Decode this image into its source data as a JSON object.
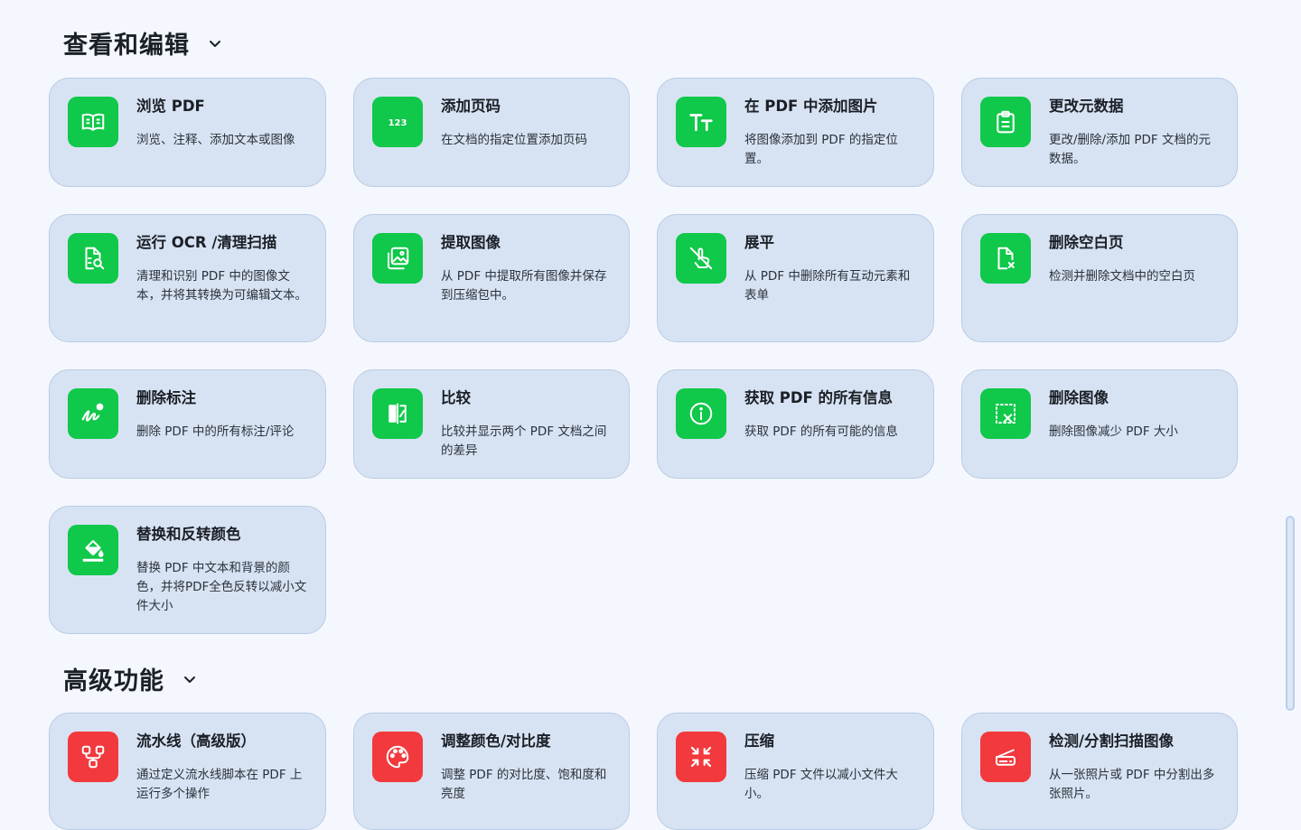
{
  "sections": [
    {
      "title": "查看和编辑"
    },
    {
      "title": "高级功能"
    }
  ],
  "cards": [
    {
      "title": "浏览 PDF",
      "desc": "浏览、注释、添加文本或图像",
      "icon": "book-open-icon"
    },
    {
      "title": "添加页码",
      "desc": "在文档的指定位置添加页码",
      "icon": "numbers-123-icon"
    },
    {
      "title": "在 PDF 中添加图片",
      "desc": "将图像添加到 PDF 的指定位置。",
      "icon": "text-size-icon"
    },
    {
      "title": "更改元数据",
      "desc": "更改/删除/添加 PDF 文档的元数据。",
      "icon": "clipboard-icon"
    },
    {
      "title": "运行 OCR /清理扫描",
      "desc": "清理和识别 PDF 中的图像文本，并将其转换为可编辑文本。",
      "icon": "file-search-icon"
    },
    {
      "title": "提取图像",
      "desc": "从 PDF 中提取所有图像并保存到压缩包中。",
      "icon": "image-stack-icon"
    },
    {
      "title": "展平",
      "desc": "从 PDF 中删除所有互动元素和表单",
      "icon": "touch-off-icon"
    },
    {
      "title": "删除空白页",
      "desc": "检测并删除文档中的空白页",
      "icon": "file-remove-icon"
    },
    {
      "title": "删除标注",
      "desc": "删除 PDF 中的所有标注/评论",
      "icon": "scribble-icon"
    },
    {
      "title": "比较",
      "desc": "比较并显示两个 PDF 文档之间的差异",
      "icon": "compare-icon"
    },
    {
      "title": "获取 PDF 的所有信息",
      "desc": "获取 PDF 的所有可能的信息",
      "icon": "info-icon"
    },
    {
      "title": "删除图像",
      "desc": "删除图像减少 PDF 大小",
      "icon": "image-remove-icon"
    },
    {
      "title": "替换和反转颜色",
      "desc": "替换 PDF 中文本和背景的颜色，并将PDF全色反转以减小文件大小",
      "icon": "paint-bucket-icon"
    },
    {
      "title": "流水线（高级版）",
      "desc": "通过定义流水线脚本在 PDF 上运行多个操作",
      "icon": "pipeline-icon"
    },
    {
      "title": "调整颜色/对比度",
      "desc": "调整 PDF 的对比度、饱和度和亮度",
      "icon": "palette-icon"
    },
    {
      "title": "压缩",
      "desc": "压缩 PDF 文件以减小文件大小。",
      "icon": "compress-icon"
    },
    {
      "title": "检测/分割扫描图像",
      "desc": "从一张照片或 PDF 中分割出多张照片。",
      "icon": "scanner-icon"
    }
  ],
  "colors": {
    "green": "#10c84a",
    "red": "#f2393d",
    "card_bg": "#d7e3f3",
    "page_bg": "#f4f7fd"
  }
}
